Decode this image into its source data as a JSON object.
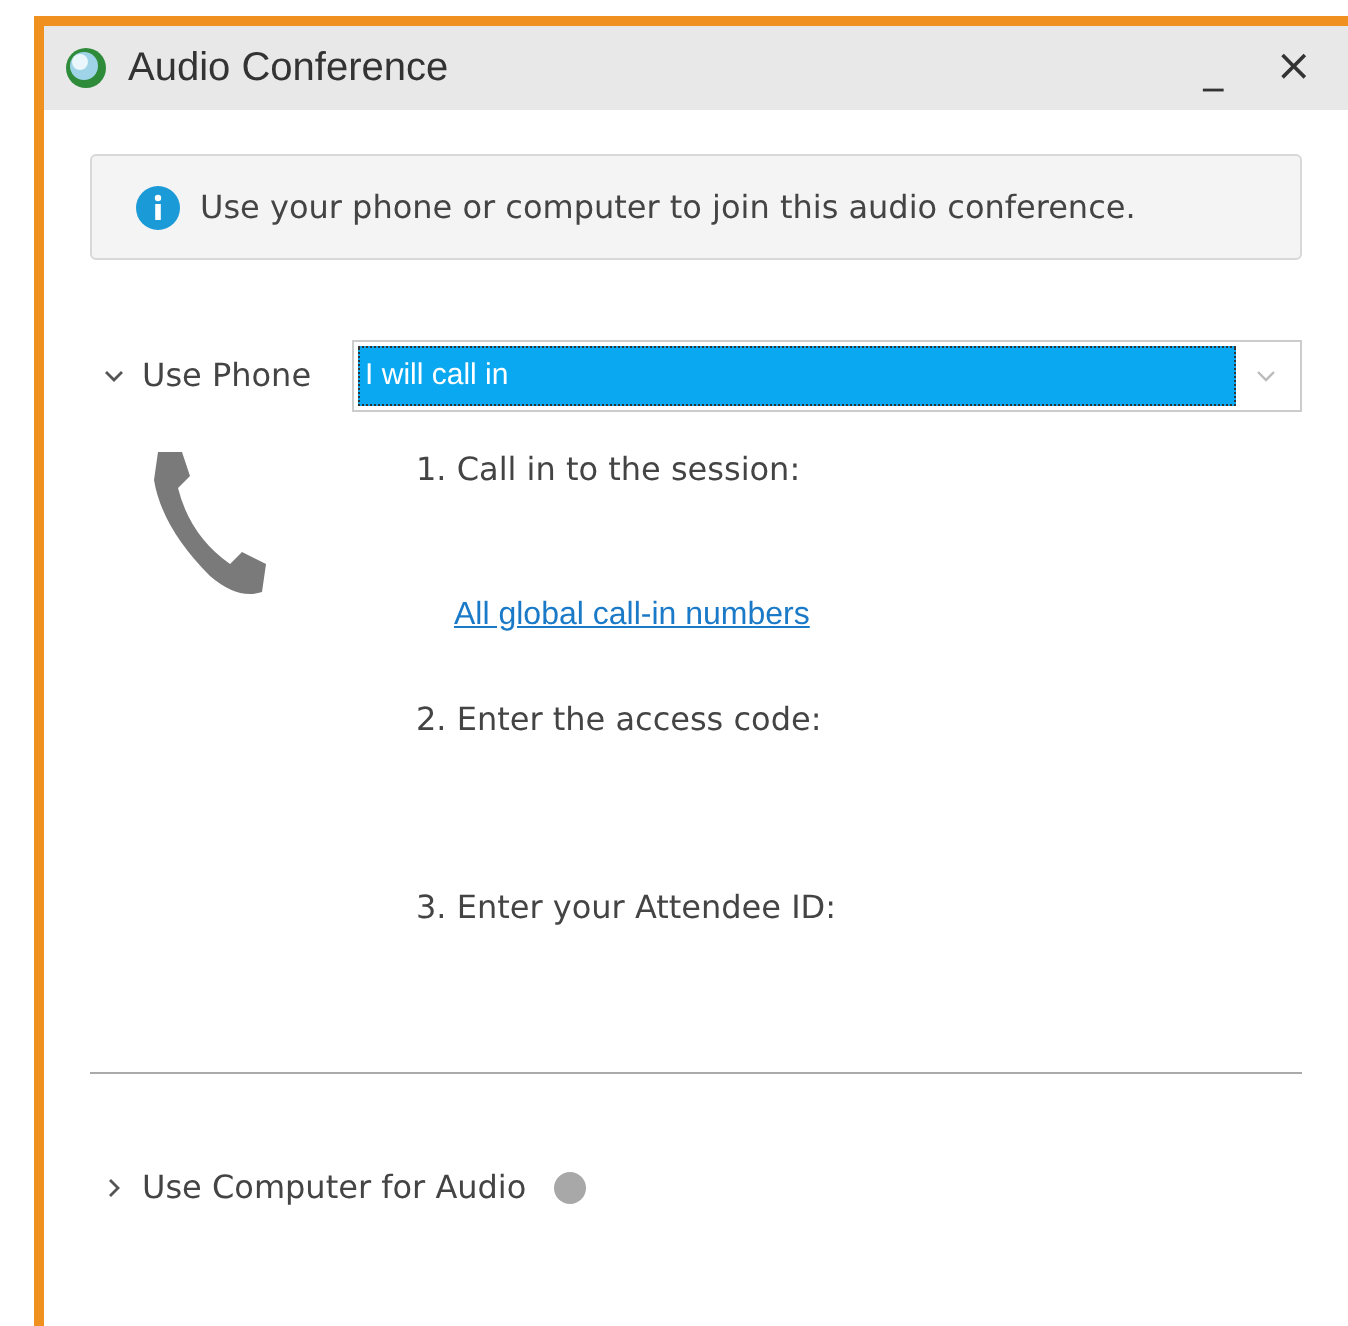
{
  "window": {
    "title": "Audio Conference",
    "controls": [
      "_",
      "×"
    ]
  },
  "info": {
    "text": "Use your phone or computer to join this audio conference."
  },
  "sections": [
    {
      "label": "Use Phone",
      "expanded": true,
      "dropdown": {
        "value": "I will call in"
      },
      "steps": [
        {
          "text": "1. Call in to the session:",
          "link": "All global call-in numbers"
        },
        {
          "text": "2. Enter the access code:"
        },
        {
          "text": "3. Enter your Attendee ID:"
        }
      ]
    },
    {
      "label": "Use Computer for Audio",
      "expanded": false
    }
  ]
}
